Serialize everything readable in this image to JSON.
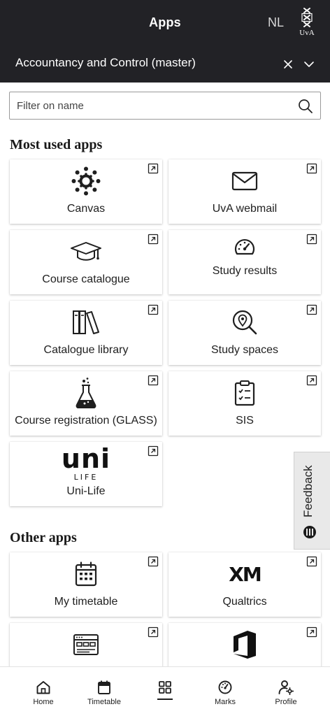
{
  "header": {
    "title": "Apps",
    "language": "NL",
    "logo_text": "UvA",
    "program": "Accountancy and Control (master)"
  },
  "search": {
    "placeholder": "Filter on name"
  },
  "sections": {
    "most_used": {
      "title": "Most used apps",
      "apps": [
        {
          "label": "Canvas",
          "icon": "canvas-icon"
        },
        {
          "label": "UvA webmail",
          "icon": "mail-icon"
        },
        {
          "label": "Course catalogue",
          "icon": "graduation-cap-icon"
        },
        {
          "label": "Study results",
          "icon": "speedometer-icon"
        },
        {
          "label": "Catalogue library",
          "icon": "books-icon"
        },
        {
          "label": "Study spaces",
          "icon": "location-search-icon"
        },
        {
          "label": "Course registration (GLASS)",
          "icon": "flask-icon"
        },
        {
          "label": "SIS",
          "icon": "clipboard-checklist-icon"
        },
        {
          "label": "Uni-Life",
          "icon": "uni-life-logo",
          "logo_main": "uni",
          "logo_sub": "LIFE"
        }
      ]
    },
    "other": {
      "title": "Other apps",
      "apps": [
        {
          "label": "My timetable",
          "icon": "calendar-icon"
        },
        {
          "label": "Qualtrics",
          "icon": "qualtrics-logo",
          "logo_text": "XM"
        },
        {
          "label": "",
          "icon": "browser-window-icon"
        },
        {
          "label": "",
          "icon": "office-logo"
        }
      ]
    }
  },
  "feedback": {
    "label": "Feedback",
    "icon": "feedback-icon"
  },
  "bottom_nav": {
    "active": "apps",
    "items": [
      {
        "key": "home",
        "label": "Home",
        "icon": "home-icon"
      },
      {
        "key": "timetable",
        "label": "Timetable",
        "icon": "calendar-icon"
      },
      {
        "key": "apps",
        "label": "",
        "icon": "apps-grid-icon"
      },
      {
        "key": "marks",
        "label": "Marks",
        "icon": "speedometer-icon"
      },
      {
        "key": "profile",
        "label": "Profile",
        "icon": "profile-settings-icon"
      }
    ]
  },
  "colors": {
    "header_bg": "#222226",
    "text": "#1f1f1f",
    "feedback_bg": "#e9e9e9"
  }
}
